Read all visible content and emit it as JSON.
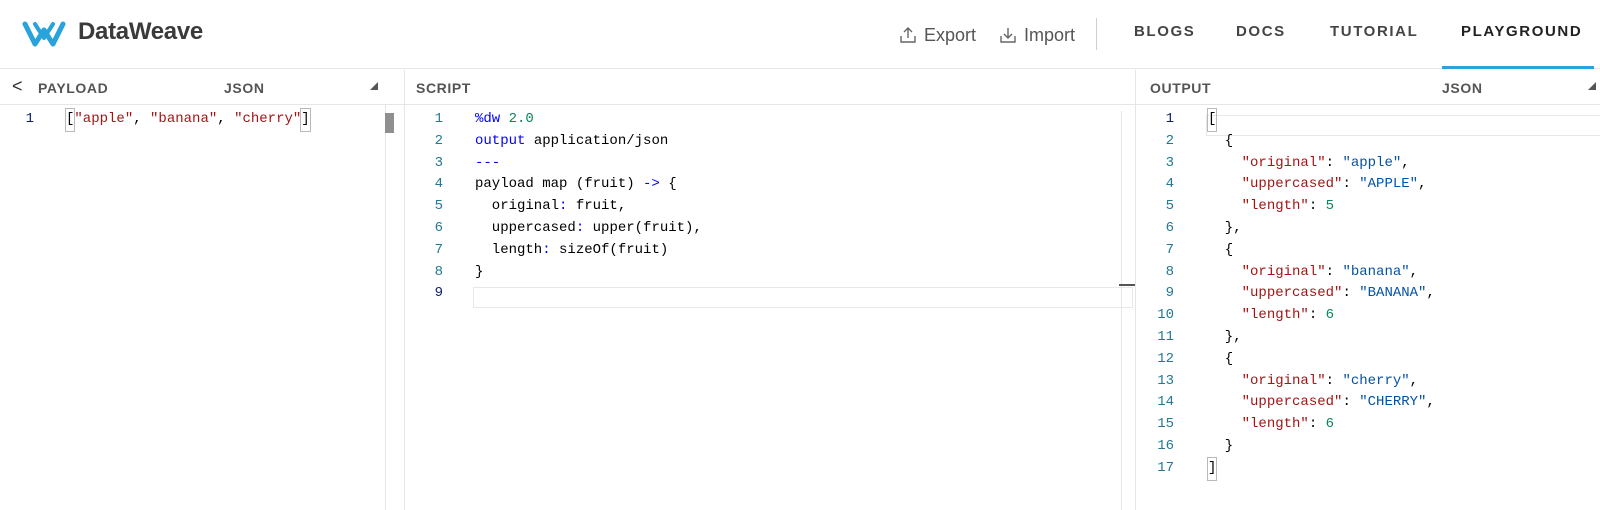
{
  "header": {
    "brand": "DataWeave",
    "logo_icon": "dataweave-logo-icon",
    "accent_color": "#2aa2dc",
    "export_label": "Export",
    "import_label": "Import",
    "nav": [
      "BLOGS",
      "DOCS",
      "TUTORIAL",
      "PLAYGROUND"
    ],
    "active_nav": "PLAYGROUND"
  },
  "payload": {
    "title": "PAYLOAD",
    "format": "JSON",
    "collapse_icon": "<",
    "lines": [
      [
        [
          "txt",
          "["
        ],
        [
          "str",
          "\"apple\""
        ],
        [
          "txt",
          ", "
        ],
        [
          "str",
          "\"banana\""
        ],
        [
          "txt",
          ", "
        ],
        [
          "str",
          "\"cherry\""
        ],
        [
          "txt",
          "]"
        ]
      ]
    ]
  },
  "script": {
    "title": "SCRIPT",
    "lines": [
      [
        [
          "kw",
          "%dw"
        ],
        [
          "txt",
          " "
        ],
        [
          "num",
          "2.0"
        ]
      ],
      [
        [
          "kw",
          "output"
        ],
        [
          "txt",
          " application/json"
        ]
      ],
      [
        [
          "kw",
          "---"
        ]
      ],
      [
        [
          "txt",
          "payload map (fruit) "
        ],
        [
          "kw",
          "->"
        ],
        [
          "txt",
          " {"
        ]
      ],
      [
        [
          "txt",
          "  original"
        ],
        [
          "kw",
          ":"
        ],
        [
          "txt",
          " fruit,"
        ]
      ],
      [
        [
          "txt",
          "  uppercased"
        ],
        [
          "kw",
          ":"
        ],
        [
          "txt",
          " upper(fruit),"
        ]
      ],
      [
        [
          "txt",
          "  length"
        ],
        [
          "kw",
          ":"
        ],
        [
          "txt",
          " sizeOf(fruit)"
        ]
      ],
      [
        [
          "txt",
          "}"
        ]
      ],
      [
        [
          "txt",
          ""
        ]
      ]
    ]
  },
  "output": {
    "title": "OUTPUT",
    "format": "JSON",
    "lines": [
      [
        [
          "txt",
          "["
        ]
      ],
      [
        [
          "txt",
          "  {"
        ]
      ],
      [
        [
          "txt",
          "    "
        ],
        [
          "key",
          "\"original\""
        ],
        [
          "txt",
          ": "
        ],
        [
          "sval",
          "\"apple\""
        ],
        [
          "txt",
          ","
        ]
      ],
      [
        [
          "txt",
          "    "
        ],
        [
          "key",
          "\"uppercased\""
        ],
        [
          "txt",
          ": "
        ],
        [
          "sval",
          "\"APPLE\""
        ],
        [
          "txt",
          ","
        ]
      ],
      [
        [
          "txt",
          "    "
        ],
        [
          "key",
          "\"length\""
        ],
        [
          "txt",
          ": "
        ],
        [
          "num",
          "5"
        ]
      ],
      [
        [
          "txt",
          "  },"
        ]
      ],
      [
        [
          "txt",
          "  {"
        ]
      ],
      [
        [
          "txt",
          "    "
        ],
        [
          "key",
          "\"original\""
        ],
        [
          "txt",
          ": "
        ],
        [
          "sval",
          "\"banana\""
        ],
        [
          "txt",
          ","
        ]
      ],
      [
        [
          "txt",
          "    "
        ],
        [
          "key",
          "\"uppercased\""
        ],
        [
          "txt",
          ": "
        ],
        [
          "sval",
          "\"BANANA\""
        ],
        [
          "txt",
          ","
        ]
      ],
      [
        [
          "txt",
          "    "
        ],
        [
          "key",
          "\"length\""
        ],
        [
          "txt",
          ": "
        ],
        [
          "num",
          "6"
        ]
      ],
      [
        [
          "txt",
          "  },"
        ]
      ],
      [
        [
          "txt",
          "  {"
        ]
      ],
      [
        [
          "txt",
          "    "
        ],
        [
          "key",
          "\"original\""
        ],
        [
          "txt",
          ": "
        ],
        [
          "sval",
          "\"cherry\""
        ],
        [
          "txt",
          ","
        ]
      ],
      [
        [
          "txt",
          "    "
        ],
        [
          "key",
          "\"uppercased\""
        ],
        [
          "txt",
          ": "
        ],
        [
          "sval",
          "\"CHERRY\""
        ],
        [
          "txt",
          ","
        ]
      ],
      [
        [
          "txt",
          "    "
        ],
        [
          "key",
          "\"length\""
        ],
        [
          "txt",
          ": "
        ],
        [
          "num",
          "6"
        ]
      ],
      [
        [
          "txt",
          "  }"
        ]
      ],
      [
        [
          "txt",
          "]"
        ]
      ]
    ]
  }
}
